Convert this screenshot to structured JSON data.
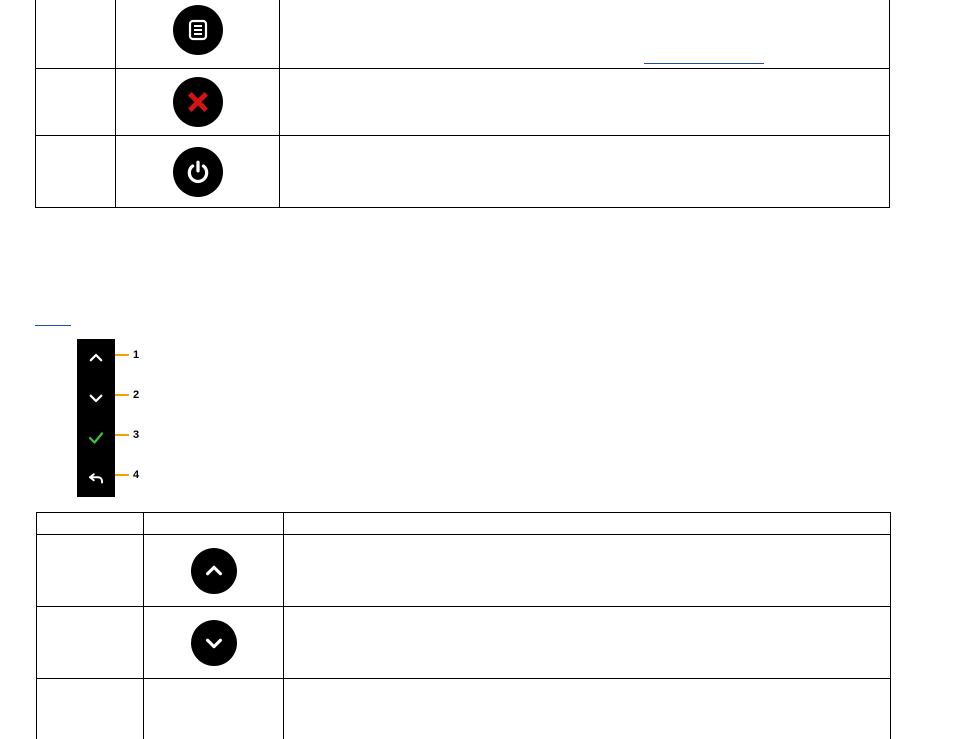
{
  "table1": {
    "rows": [
      {
        "label": "",
        "desc": "",
        "link": ""
      },
      {
        "label": "",
        "desc": "",
        "link": ""
      },
      {
        "label": "",
        "desc": "",
        "link": ""
      }
    ]
  },
  "section_link": "",
  "remote_callouts": [
    "1",
    "2",
    "3",
    "4"
  ],
  "table2": {
    "header": [
      "",
      "",
      ""
    ],
    "rows": [
      {
        "label": "",
        "desc": ""
      },
      {
        "label": "",
        "desc": ""
      }
    ]
  }
}
